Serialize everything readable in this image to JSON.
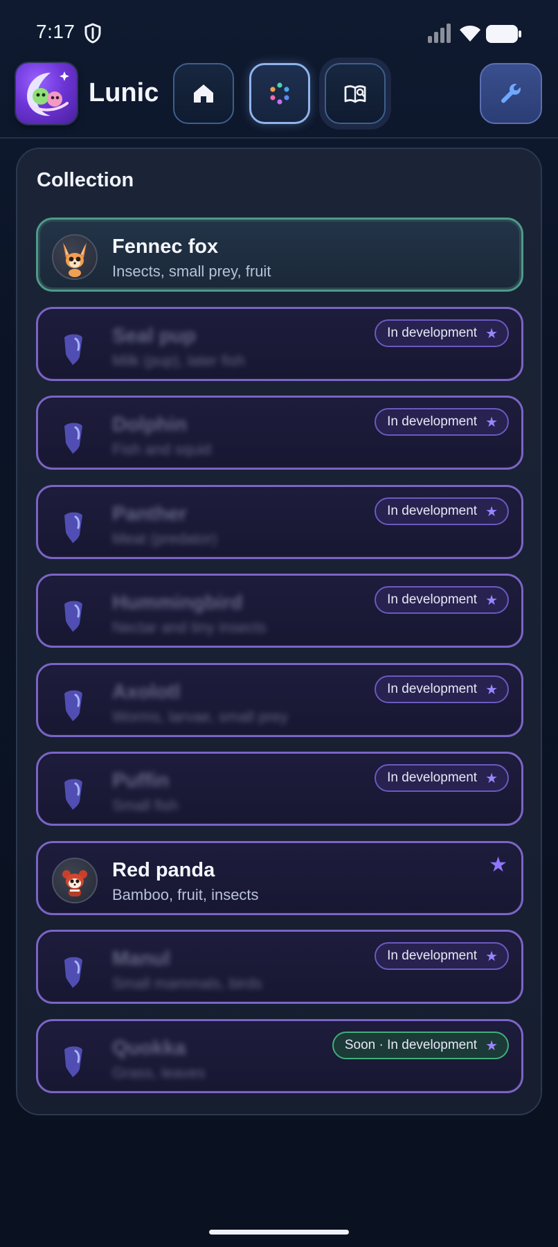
{
  "status_bar": {
    "time": "7:17",
    "icons": [
      "shield-icon",
      "signal-icon",
      "wifi-icon",
      "battery-icon"
    ]
  },
  "app_bar": {
    "title": "Lunic",
    "logo_icon": "moon-creatures-logo",
    "nav": [
      {
        "name": "home",
        "icon": "home-icon"
      },
      {
        "name": "collection",
        "icon": "dots-icon",
        "selected": true
      },
      {
        "name": "book",
        "icon": "book-icon"
      },
      {
        "name": "settings",
        "icon": "wrench-icon"
      }
    ]
  },
  "collection": {
    "title": "Collection",
    "items": [
      {
        "name": "Fennec fox",
        "diet": "Insects, small prey, fruit",
        "locked": false,
        "active": true,
        "badge": "",
        "icon": "fennec-fox-avatar"
      },
      {
        "name": "Seal pup",
        "diet": "Milk (pup), later fish",
        "locked": true,
        "badge": "In development",
        "icon": "locked-gem-icon"
      },
      {
        "name": "Dolphin",
        "diet": "Fish and squid",
        "locked": true,
        "badge": "In development",
        "icon": "locked-gem-icon"
      },
      {
        "name": "Panther",
        "diet": "Meat (predator)",
        "locked": true,
        "badge": "In development",
        "icon": "locked-gem-icon"
      },
      {
        "name": "Hummingbird",
        "diet": "Nectar and tiny insects",
        "locked": true,
        "badge": "In development",
        "icon": "locked-gem-icon"
      },
      {
        "name": "Axolotl",
        "diet": "Worms, larvae, small prey",
        "locked": true,
        "badge": "In development",
        "icon": "locked-gem-icon"
      },
      {
        "name": "Puffin",
        "diet": "Small fish",
        "locked": true,
        "badge": "In development",
        "icon": "locked-gem-icon"
      },
      {
        "name": "Red panda",
        "diet": "Bamboo, fruit, insects",
        "locked": false,
        "badge": "",
        "starred": true,
        "icon": "red-panda-avatar"
      },
      {
        "name": "Manul",
        "diet": "Small mammals, birds",
        "locked": true,
        "badge": "In development",
        "icon": "locked-gem-icon"
      },
      {
        "name": "Quokka",
        "diet": "Grass, leaves",
        "locked": true,
        "badge": "Soon · In development",
        "badge_variant": "soon",
        "icon": "locked-gem-icon"
      }
    ],
    "badge_star": "★",
    "colors": {
      "active_border": "#4f9a8a",
      "card_border": "#7b64c6",
      "soon_border": "#3fb07a",
      "star": "#9b84ff"
    }
  }
}
